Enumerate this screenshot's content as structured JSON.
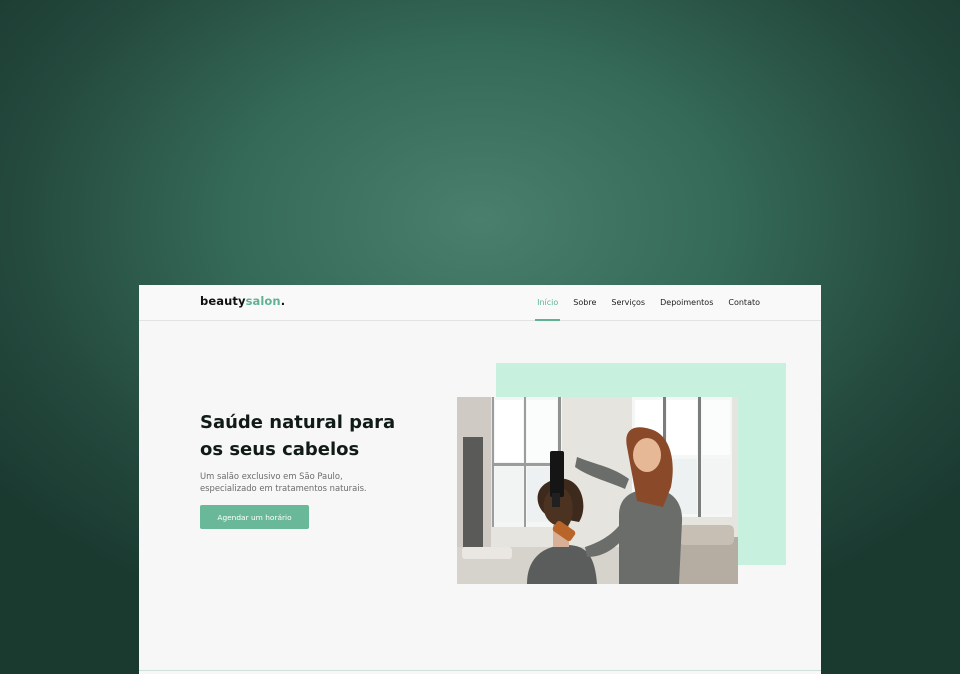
{
  "brand": {
    "logo_main": "beauty",
    "logo_accent": "salon",
    "logo_dot": ".",
    "accent_color": "#5fb393",
    "mint_color": "#c8f0de",
    "text_color": "#111b16"
  },
  "nav": {
    "items": [
      {
        "label": "Início",
        "active": true
      },
      {
        "label": "Sobre",
        "active": false
      },
      {
        "label": "Serviços",
        "active": false
      },
      {
        "label": "Depoimentos",
        "active": false
      },
      {
        "label": "Contato",
        "active": false
      }
    ]
  },
  "hero": {
    "title_line1": "Saúde natural para",
    "title_line2": "os seus cabelos",
    "subtitle_line1": "Um salão exclusivo em São Paulo,",
    "subtitle_line2": "especializado em tratamentos naturais.",
    "cta_label": "Agendar um  horário"
  },
  "image": {
    "semantic": "hairdresser-drying-client-hair-photo"
  }
}
